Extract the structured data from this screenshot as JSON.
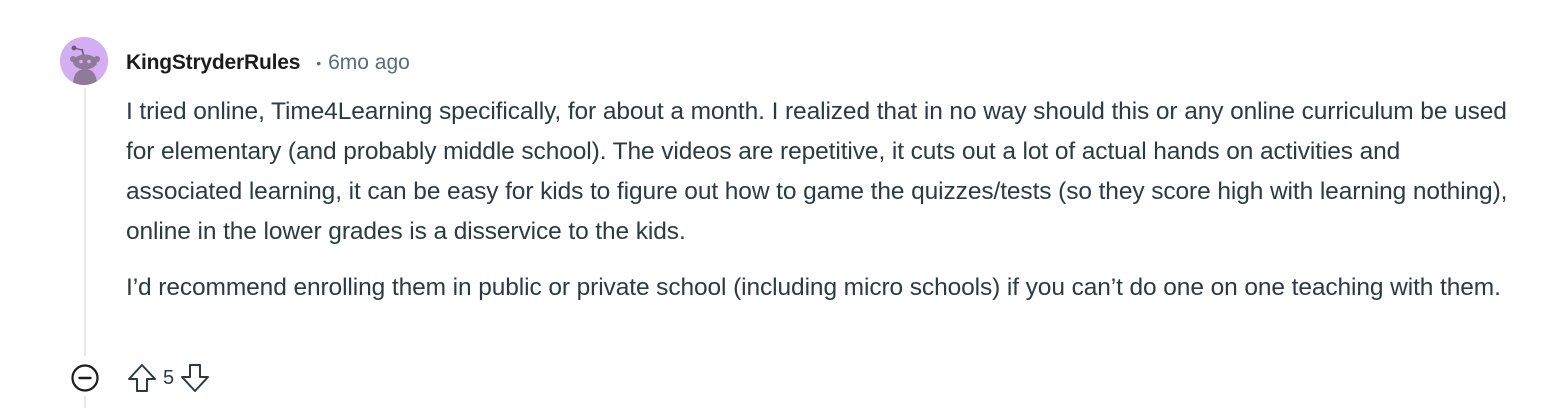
{
  "comment": {
    "author": "KingStryderRules",
    "separator": "•",
    "timestamp": "6mo ago",
    "paragraphs": [
      "I tried online, Time4Learning specifically, for about a month. I realized that in no way should this or any online curriculum be used for elementary (and probably middle school). The videos are repetitive, it cuts out a lot of actual hands on activities and associated learning, it can be easy for kids to figure out how to game the quizzes/tests (so they score high with learning nothing), online in the lower grades is a disservice to the kids.",
      "I’d recommend enrolling them in public or private school (including micro schools) if you can’t do one on one teaching with them."
    ],
    "score": "5"
  },
  "icons": {
    "avatar": "snoo-avatar-icon",
    "collapse": "collapse-minus-icon",
    "upvote": "upvote-arrow-icon",
    "downvote": "downvote-arrow-icon"
  },
  "colors": {
    "avatar_bg": "#d4aef2",
    "text": "#2a3c42",
    "meta": "#576f76",
    "thread_line": "#e5e7e8"
  }
}
